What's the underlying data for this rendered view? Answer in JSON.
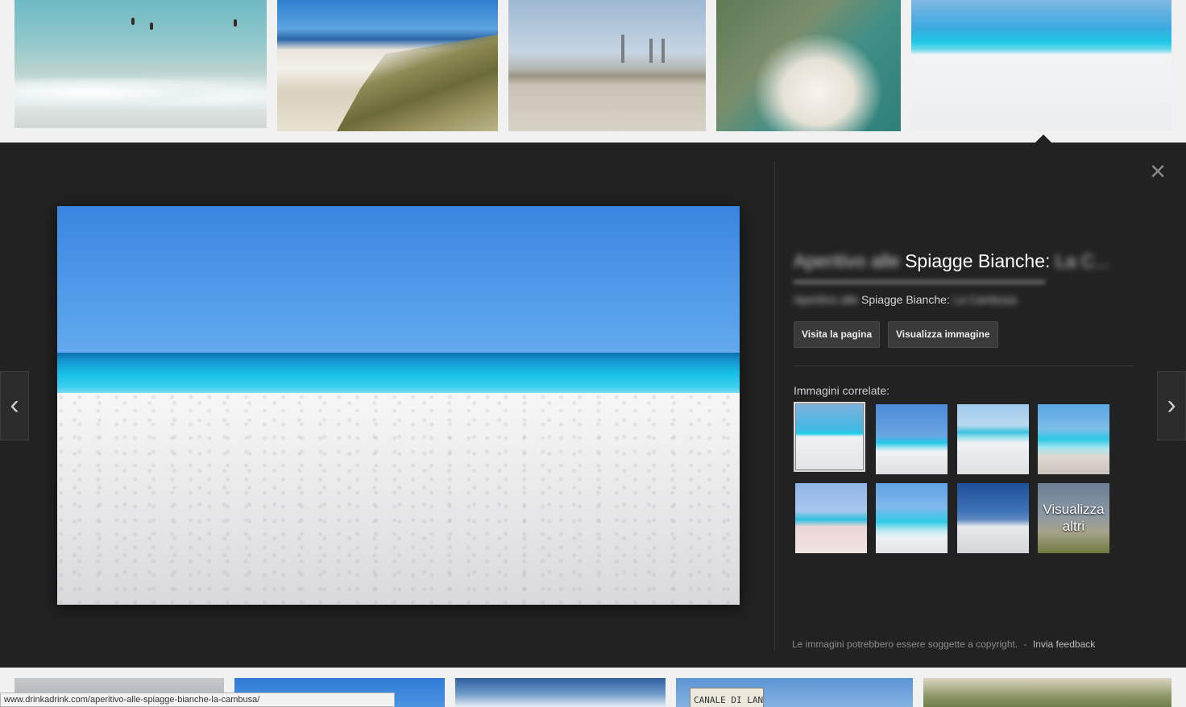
{
  "detail": {
    "title_blurred_start": "Aperitivo alle",
    "title_visible": "Spiagge Bianche:",
    "title_blurred_end": "La C...",
    "subtitle_blurred_start": "Aperitivo alle",
    "subtitle_visible": "Spiagge Bianche:",
    "subtitle_blurred_end": "La Cambusa",
    "visit_button": "Visita la pagina",
    "view_button": "Visualizza immagine",
    "related_label": "Immagini correlate:",
    "more_label_line1": "Visualizza",
    "more_label_line2": "altri",
    "copyright_text": "Le immagini potrebbero essere soggette a copyright.",
    "copyright_sep": "-",
    "feedback_link": "Invia feedback",
    "close_symbol": "×",
    "prev_symbol": "‹",
    "next_symbol": "›"
  },
  "bottom_row": {
    "sign_text": "CANALE DI LANCIO"
  },
  "status_bar": {
    "url": "www.drinkadrink.com/aperitivo-alle-spiagge-bianche-la-cambusa/"
  },
  "icons": {
    "close": "close-icon",
    "prev": "chevron-left-icon",
    "next": "chevron-right-icon"
  },
  "colors": {
    "panel_bg": "#222222",
    "button_bg": "#3a3a3a"
  }
}
